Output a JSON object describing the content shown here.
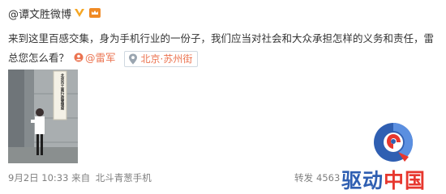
{
  "post": {
    "username": "@谭文胜微博",
    "body_text": "来到这里百感交集，身为手机行业的一份子，我们应当对社会和大众承担怎样的义务和责任，雷总您怎么看？",
    "mention": "@雷军",
    "location": "北京·苏州街",
    "date": "9月2日",
    "time": "10:33",
    "source_label": "来自",
    "source": "北斗青葱手机",
    "forward_label": "转发",
    "forward_count": "4563"
  },
  "photo": {
    "sign_text": "北京市工商行政管理局"
  },
  "watermark": {
    "part1": "驱动",
    "part2": "中国"
  },
  "icons": {
    "verified": "verified-v-icon",
    "vip": "vip-crown-icon",
    "mention": "mention-icon",
    "location": "location-pin-icon"
  },
  "colors": {
    "link": "#eb7350",
    "text": "#333333",
    "meta": "#808080",
    "verified": "#f5a623",
    "logo_blue": "#2f5fb2",
    "logo_red": "#e7372e"
  }
}
